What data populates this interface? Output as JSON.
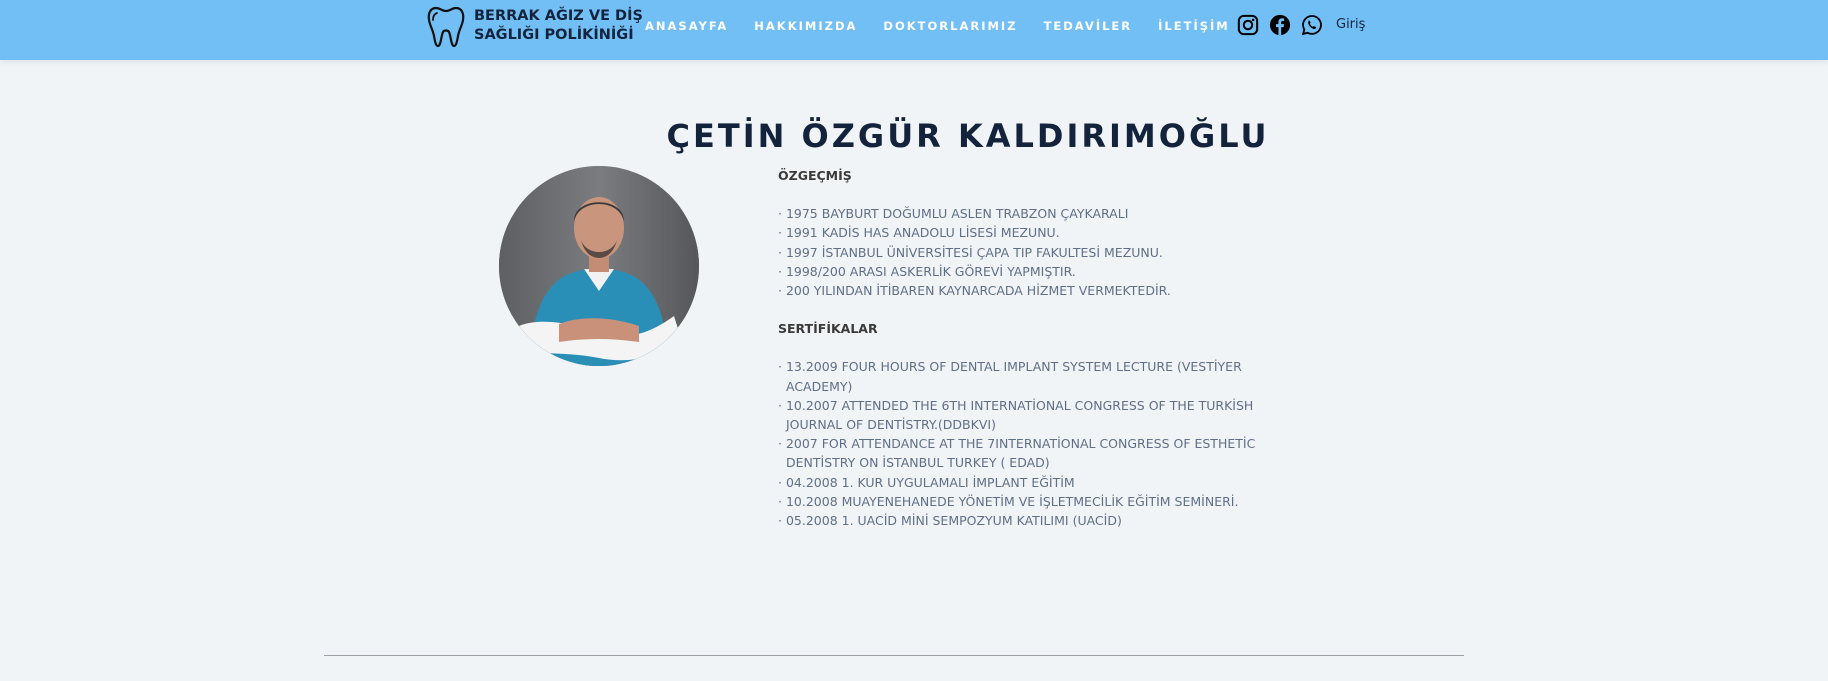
{
  "header": {
    "logo": {
      "line1": "BERRAK AĞIZ VE DİŞ",
      "line2": "SAĞLIĞI POLİKİNİĞİ",
      "icon": "tooth-icon"
    },
    "nav": [
      "ANASAYFA",
      "HAKKIMIZDA",
      "DOKTORLARIMIZ",
      "TEDAVİLER",
      "İLETİŞİM"
    ],
    "social_icons": [
      "instagram-icon",
      "facebook-icon",
      "whatsapp-icon"
    ],
    "login_label": "Giriş",
    "background_color": "#72bff6"
  },
  "doctor": {
    "name": "ÇETİN ÖZGÜR KALDIRIMOĞLU",
    "biography_title": "ÖZGEÇMİŞ",
    "biography": [
      "1975 BAYBURT DOĞUMLU ASLEN TRABZON ÇAYKARALI",
      "1991 KADİS HAS ANADOLU LİSESİ MEZUNU.",
      "1997 İSTANBUL ÜNİVERSİTESİ ÇAPA TIP FAKULTESİ MEZUNU.",
      "1998/200 ARASI ASKERLİK GÖREVİ YAPMIŞTIR.",
      "200 YILINDAN İTİBAREN KAYNARCADA HİZMET VERMEKTEDİR."
    ],
    "certificates_title": "SERTİFİKALAR",
    "certificates": [
      "13.2009 FOUR HOURS OF DENTAL IMPLANT SYSTEM LECTURE (VESTİYER ACADEMY)",
      "10.2007 ATTENDED THE 6TH INTERNATİONAL CONGRESS OF THE TURKİSH JOURNAL OF DENTİSTRY.(DDBKVI)",
      "2007 FOR ATTENDANCE AT THE 7INTERNATİONAL CONGRESS OF ESTHETİC DENTİSTRY ON İSTANBUL TURKEY ( EDAD)",
      "04.2008 1. KUR UYGULAMALI İMPLANT EĞİTİM",
      "10.2008 MUAYENEHANEDE YÖNETİM VE İŞLETMECİLİK EĞİTİM SEMİNERİ.",
      "05.2008 1. UACİD MİNİ SEMPOZYUM KATILIMI (UACİD)"
    ]
  },
  "colors": {
    "page_background": "#f1f4f7",
    "heading": "#14233c",
    "body_text": "#5f6f85"
  }
}
